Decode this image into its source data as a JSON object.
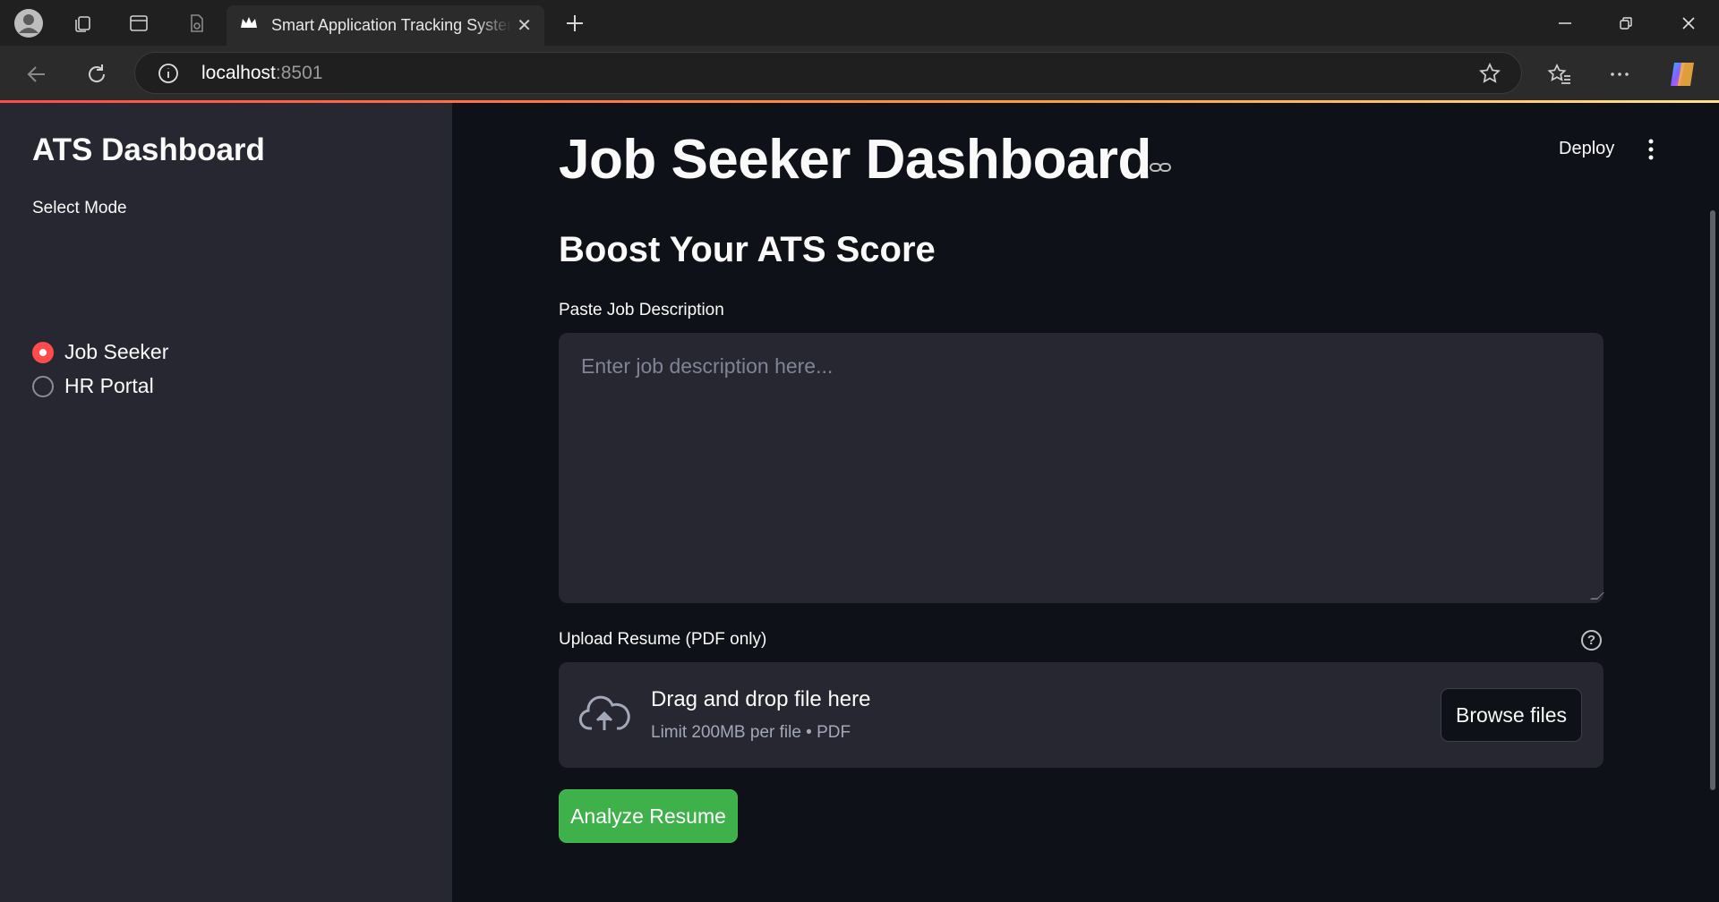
{
  "browser": {
    "tab_title": "Smart Application Tracking System",
    "url_host": "localhost",
    "url_port": ":8501"
  },
  "sidebar": {
    "title": "ATS Dashboard",
    "mode_label": "Select Mode",
    "options": [
      {
        "label": "Job Seeker",
        "selected": true
      },
      {
        "label": "HR Portal",
        "selected": false
      }
    ]
  },
  "main": {
    "title": "Job Seeker Dashboard",
    "deploy_label": "Deploy",
    "subtitle": "Boost Your ATS Score",
    "jd_label": "Paste Job Description",
    "jd_placeholder": "Enter job description here...",
    "upload_label": "Upload Resume (PDF only)",
    "dropzone_main": "Drag and drop file here",
    "dropzone_sub": "Limit 200MB per file • PDF",
    "browse_label": "Browse files",
    "analyze_label": "Analyze Resume"
  },
  "colors": {
    "accent": "#ff4b4b",
    "primary_button": "#3fb14b",
    "sidebar_bg": "#262730",
    "main_bg": "#0e1117"
  }
}
